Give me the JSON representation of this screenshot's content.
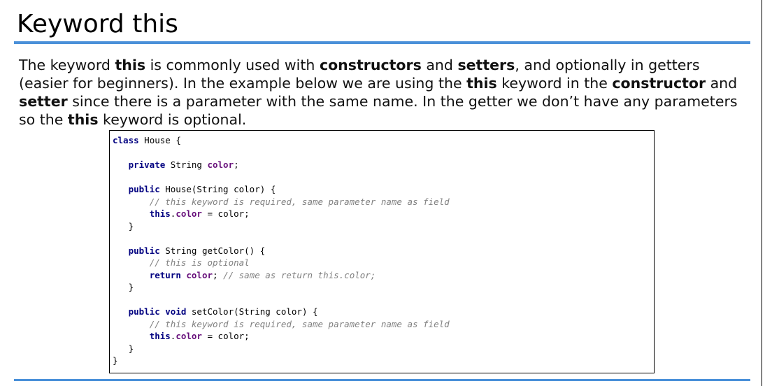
{
  "slide": {
    "title": "Keyword this"
  },
  "paragraph": {
    "p1": "The keyword ",
    "b1": "this",
    "p2": " is commonly used with ",
    "b2": "constructors",
    "p3": " and ",
    "b3": "setters",
    "p4": ", and optionally in getters (easier for beginners). In the example below we are using the ",
    "b4": "this",
    "p5": " keyword in the ",
    "b5": "constructor",
    "p6": " and ",
    "b6": "setter",
    "p7": " since there is a parameter with the same name. In the getter we don’t have any parameters so the ",
    "b7": "this",
    "p8": " keyword is optional."
  },
  "code": {
    "kw_class": "class",
    "t_class_decl": " House {",
    "kw_private": "private",
    "t_string_type1": " String ",
    "fld_color1": "color",
    "t_semi1": ";",
    "kw_public1": "public",
    "t_ctor_sig": " House(String color) {",
    "cm_ctor": "// this keyword is required, same parameter name as field",
    "kw_this1": "this",
    "t_dot1": ".",
    "fld_color2": "color",
    "t_assign1": " = color;",
    "t_close1": "}",
    "kw_public2": "public",
    "t_getter_sig": " String getColor() {",
    "cm_getter": "// this is optional",
    "kw_return": "return",
    "t_space": " ",
    "fld_color3": "color",
    "t_semi2": "; ",
    "cm_return": "// same as return this.color;",
    "t_close2": "}",
    "kw_public3": "public",
    "t_space2": " ",
    "kw_void": "void",
    "t_setter_sig": " setColor(String color) {",
    "cm_setter": "// this keyword is required, same parameter name as field",
    "kw_this2": "this",
    "t_dot2": ".",
    "fld_color4": "color",
    "t_assign2": " = color;",
    "t_close3": "}",
    "t_close_class": "}"
  },
  "colors": {
    "accent_rule": "#4a90d9",
    "keyword": "#000080",
    "field": "#660e7a",
    "comment": "#808080"
  }
}
